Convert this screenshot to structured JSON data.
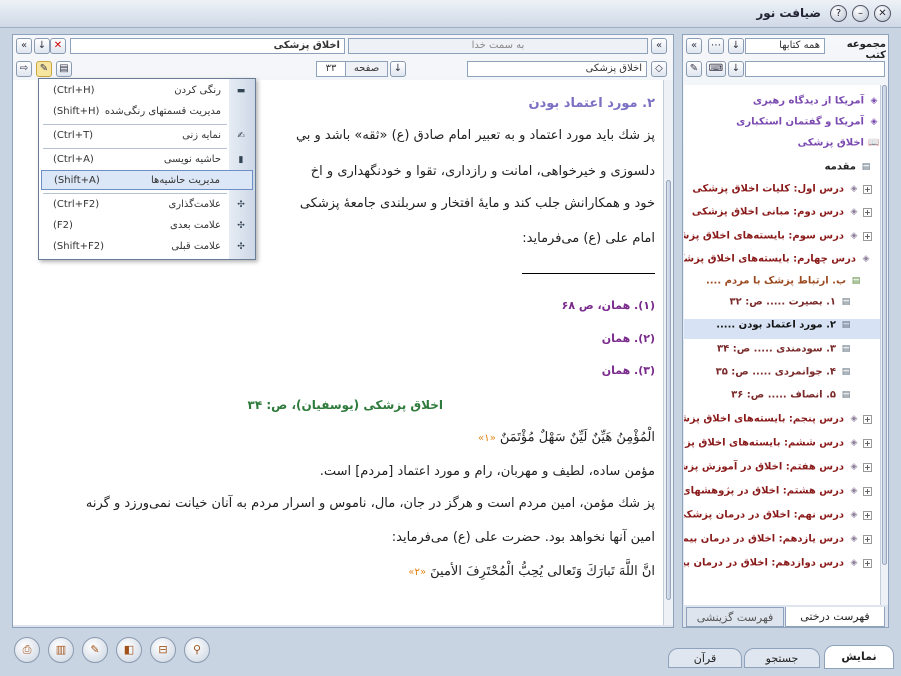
{
  "window": {
    "title": "ضیافت نور"
  },
  "content_toolbar": {
    "title": "اخلاق پزشکی",
    "direction_field": "به سمت خدا",
    "location_field": "اخلاق پزشکی",
    "page_label": "صفحه",
    "page_number": "۳۳"
  },
  "context_menu": {
    "items": [
      {
        "label": "رنگی کردن",
        "shortcut": "(Ctrl+H)",
        "icon": "highlight-icon"
      },
      {
        "label": "مدیریت قسمتهای رنگی‌شده",
        "shortcut": "(Shift+H)",
        "icon": ""
      },
      {
        "label": "نمایه زنی",
        "shortcut": "(Ctrl+T)",
        "icon": "index-icon"
      },
      {
        "label": "حاشیه نویسی",
        "shortcut": "(Ctrl+A)",
        "icon": "annotation-icon"
      },
      {
        "label": "مدیریت حاشیه‌ها",
        "shortcut": "(Shift+A)",
        "icon": ""
      },
      {
        "label": "علامت‌گذاری",
        "shortcut": "(Ctrl+F2)",
        "icon": "bookmark-icon"
      },
      {
        "label": "علامت بعدی",
        "shortcut": "(F2)",
        "icon": "next-bookmark-icon"
      },
      {
        "label": "علامت قبلی",
        "shortcut": "(Shift+F2)",
        "icon": "prev-bookmark-icon"
      }
    ]
  },
  "document": {
    "heading": "۲. مورد اعتماد بودن",
    "lines": [
      "پز شك بايد مورد اعتماد و به تعبير امام صادق (ع) «ثقه» باشد و بي",
      "دلسوزی و خیرخواهی، امانت و رازداری، تقوا و خودنگهداری و اخ",
      "خود و همکارانش جلب کند و مایهٔ افتخار و سربلندی جامعهٔ پزشکی",
      "امام علی (ع) می‌فرماید:"
    ],
    "footnotes": [
      "(۱). همان، ص ۶۸",
      "(۲). همان",
      "(۳). همان"
    ],
    "source_line": "اخلاق  پزشکی  (یوسفیان)، ص:  ۳۴",
    "hadith1": "الْمُؤْمِنُ هَيِّنٌ لَيِّنٌ سَهْلٌ مُؤْتَمَنٌ",
    "hadith1_ref": "«۱»",
    "para2": [
      "مؤمن ساده، لطیف و مهربان، رام و مورد اعتماد [مردم] است.",
      "پز شك مؤمن، امين مردم است و هرگز در جان، مال، ناموس و اسرار مردم به آنان خيانت نمی‌ورزد و گرنه",
      "امين آنها نخواهد بود. حضرت علی (ع) می‌فرمايد:"
    ],
    "hadith2": "انَّ اللَّهَ تَبارَكَ وَتَعالی یُحِبُّ الْمُحْتَرِفَ الأمینَ",
    "hadith2_ref": "«۲»"
  },
  "library_panel": {
    "header": "مجموعه کتب",
    "collection_select": "همه کتابها",
    "tree": [
      {
        "label": "آمریکا از دیدگاه رهبری",
        "kind": "book",
        "level": 0
      },
      {
        "label": "آمریکا و گفتمان استکباری",
        "kind": "book",
        "level": 0
      },
      {
        "label": "اخلاق پزشکی",
        "kind": "book-open",
        "level": 0
      },
      {
        "label": "مقدمه",
        "kind": "page",
        "level": 1
      },
      {
        "label": "درس اول: کلیات اخلاق پزشکی",
        "kind": "lesson",
        "level": 1
      },
      {
        "label": "درس دوم: مبانی اخلاق پزشکی",
        "kind": "lesson",
        "level": 1
      },
      {
        "label": "درس سوم: بایسته‌های اخلاق پزشکی",
        "kind": "lesson",
        "level": 1
      },
      {
        "label": "درس چهارم: بایسته‌های اخلاق پزشکی",
        "kind": "lesson-open",
        "level": 1
      },
      {
        "label": "ب. ارتباط پزشک با مردم ....",
        "kind": "sub-open",
        "level": 2
      },
      {
        "label": "۱. بصيرت ..... ص: ۳۲",
        "kind": "item",
        "level": 3
      },
      {
        "label": "۲. مورد اعتماد بودن .....",
        "kind": "item-selected",
        "level": 3
      },
      {
        "label": "۳. سودمندی ..... ص: ۳۴",
        "kind": "item",
        "level": 3
      },
      {
        "label": "۴. جوانمردی ..... ص: ۳۵",
        "kind": "item",
        "level": 3
      },
      {
        "label": "۵. انصاف ..... ص: ۳۶",
        "kind": "item",
        "level": 3
      },
      {
        "label": "درس پنجم: بایسته‌های اخلاق پزشکی",
        "kind": "lesson",
        "level": 1
      },
      {
        "label": "درس ششم: بایسته‌های اخلاق پزشکی",
        "kind": "lesson",
        "level": 1
      },
      {
        "label": "درس هفتم: اخلاق در آموزش پزشکی",
        "kind": "lesson",
        "level": 1
      },
      {
        "label": "درس هشتم: اخلاق در پژوهشهای",
        "kind": "lesson",
        "level": 1
      },
      {
        "label": "درس نهم: اخلاق در درمان پزشکی",
        "kind": "lesson",
        "level": 1
      },
      {
        "label": "درس یازدهم: اخلاق در درمان بیماران",
        "kind": "lesson",
        "level": 1
      },
      {
        "label": "درس دوازدهم: اخلاق در درمان بیماران",
        "kind": "lesson",
        "level": 1
      }
    ],
    "tabs": {
      "tree": "فهرست درختی",
      "index": "فهرست گزینشی"
    }
  },
  "bottom_tabs": [
    "نمایش",
    "جستجو",
    "قرآن"
  ],
  "colors": {
    "accent": "#6d8fc7",
    "heading": "#7a6fc2",
    "source": "#2d7a3a",
    "lesson": "#8a1a1a"
  }
}
